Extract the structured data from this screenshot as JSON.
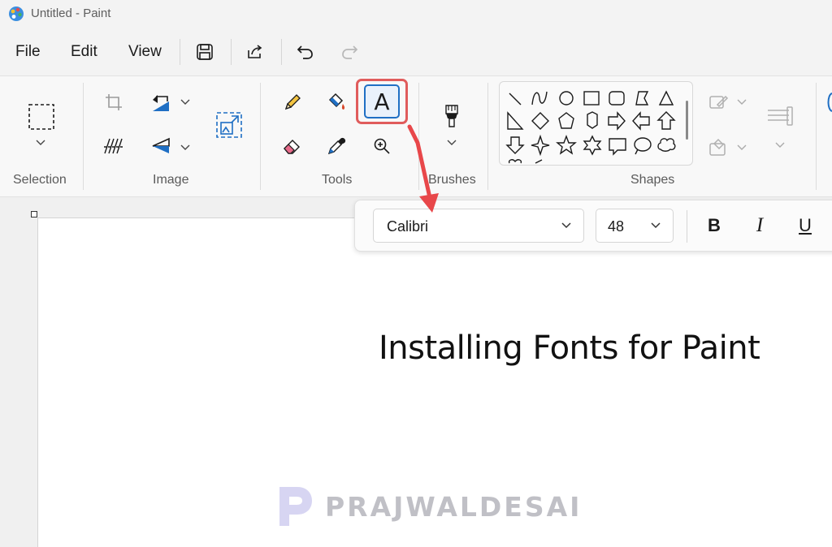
{
  "window": {
    "title": "Untitled - Paint"
  },
  "menu": {
    "file": "File",
    "edit": "Edit",
    "view": "View"
  },
  "ribbon": {
    "groups": {
      "selection": "Selection",
      "image": "Image",
      "tools": "Tools",
      "brushes": "Brushes",
      "shapes": "Shapes"
    },
    "text_tool_glyph": "A"
  },
  "text_toolbar": {
    "font_family": "Calibri",
    "font_size": "48",
    "bold": "B",
    "italic": "I",
    "underline": "U"
  },
  "canvas": {
    "text": "Installing Fonts for Paint"
  },
  "watermark": {
    "text": "PRAJWALDESAI"
  },
  "colors": {
    "accent": "#1f6fc4",
    "highlight": "#e05c5c",
    "arrow": "#e8474a"
  }
}
